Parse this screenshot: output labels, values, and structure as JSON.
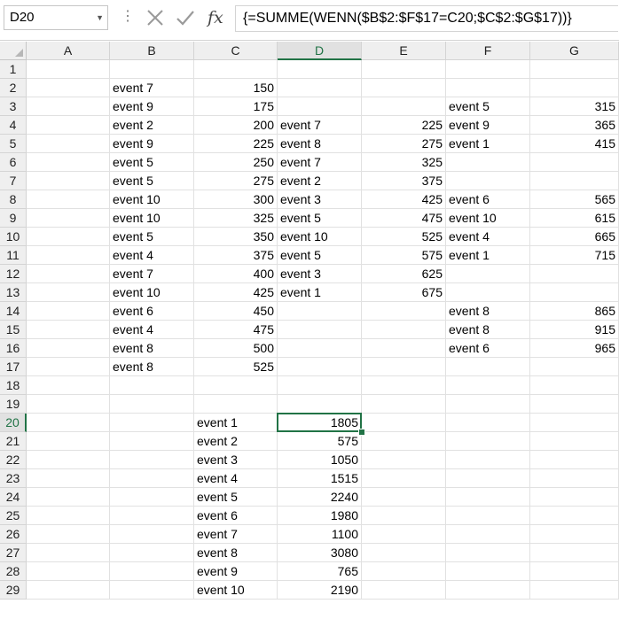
{
  "formula_bar": {
    "name_box": "D20",
    "formula": "{=SUMME(WENN($B$2:$F$17=C20;$C$2:$G$17))}"
  },
  "sheet": {
    "active_cell": "D20",
    "columns": [
      "A",
      "B",
      "C",
      "D",
      "E",
      "F",
      "G"
    ],
    "rows": [
      "1",
      "2",
      "3",
      "4",
      "5",
      "6",
      "7",
      "8",
      "9",
      "10",
      "11",
      "12",
      "13",
      "14",
      "15",
      "16",
      "17",
      "18",
      "19",
      "20",
      "21",
      "22",
      "23",
      "24",
      "25",
      "26",
      "27",
      "28",
      "29"
    ],
    "cells": [
      {
        "ref": "B2",
        "value": "event 7"
      },
      {
        "ref": "C2",
        "value": "150"
      },
      {
        "ref": "B3",
        "value": "event 9"
      },
      {
        "ref": "C3",
        "value": "175"
      },
      {
        "ref": "F3",
        "value": "event 5"
      },
      {
        "ref": "G3",
        "value": "315"
      },
      {
        "ref": "B4",
        "value": "event 2"
      },
      {
        "ref": "C4",
        "value": "200"
      },
      {
        "ref": "D4",
        "value": "event 7"
      },
      {
        "ref": "E4",
        "value": "225"
      },
      {
        "ref": "F4",
        "value": "event 9"
      },
      {
        "ref": "G4",
        "value": "365"
      },
      {
        "ref": "B5",
        "value": "event 9"
      },
      {
        "ref": "C5",
        "value": "225"
      },
      {
        "ref": "D5",
        "value": "event 8"
      },
      {
        "ref": "E5",
        "value": "275"
      },
      {
        "ref": "F5",
        "value": "event 1"
      },
      {
        "ref": "G5",
        "value": "415"
      },
      {
        "ref": "B6",
        "value": "event 5"
      },
      {
        "ref": "C6",
        "value": "250"
      },
      {
        "ref": "D6",
        "value": "event 7"
      },
      {
        "ref": "E6",
        "value": "325"
      },
      {
        "ref": "B7",
        "value": "event 5"
      },
      {
        "ref": "C7",
        "value": "275"
      },
      {
        "ref": "D7",
        "value": "event 2"
      },
      {
        "ref": "E7",
        "value": "375"
      },
      {
        "ref": "B8",
        "value": "event 10"
      },
      {
        "ref": "C8",
        "value": "300"
      },
      {
        "ref": "D8",
        "value": "event 3"
      },
      {
        "ref": "E8",
        "value": "425"
      },
      {
        "ref": "F8",
        "value": "event 6"
      },
      {
        "ref": "G8",
        "value": "565"
      },
      {
        "ref": "B9",
        "value": "event 10"
      },
      {
        "ref": "C9",
        "value": "325"
      },
      {
        "ref": "D9",
        "value": "event 5"
      },
      {
        "ref": "E9",
        "value": "475"
      },
      {
        "ref": "F9",
        "value": "event 10"
      },
      {
        "ref": "G9",
        "value": "615"
      },
      {
        "ref": "B10",
        "value": "event 5"
      },
      {
        "ref": "C10",
        "value": "350"
      },
      {
        "ref": "D10",
        "value": "event 10"
      },
      {
        "ref": "E10",
        "value": "525"
      },
      {
        "ref": "F10",
        "value": "event 4"
      },
      {
        "ref": "G10",
        "value": "665"
      },
      {
        "ref": "B11",
        "value": "event 4"
      },
      {
        "ref": "C11",
        "value": "375"
      },
      {
        "ref": "D11",
        "value": "event 5"
      },
      {
        "ref": "E11",
        "value": "575"
      },
      {
        "ref": "F11",
        "value": "event 1"
      },
      {
        "ref": "G11",
        "value": "715"
      },
      {
        "ref": "B12",
        "value": "event 7"
      },
      {
        "ref": "C12",
        "value": "400"
      },
      {
        "ref": "D12",
        "value": "event 3"
      },
      {
        "ref": "E12",
        "value": "625"
      },
      {
        "ref": "B13",
        "value": "event 10"
      },
      {
        "ref": "C13",
        "value": "425"
      },
      {
        "ref": "D13",
        "value": "event 1"
      },
      {
        "ref": "E13",
        "value": "675"
      },
      {
        "ref": "B14",
        "value": "event 6"
      },
      {
        "ref": "C14",
        "value": "450"
      },
      {
        "ref": "F14",
        "value": "event 8"
      },
      {
        "ref": "G14",
        "value": "865"
      },
      {
        "ref": "B15",
        "value": "event 4"
      },
      {
        "ref": "C15",
        "value": "475"
      },
      {
        "ref": "F15",
        "value": "event 8"
      },
      {
        "ref": "G15",
        "value": "915"
      },
      {
        "ref": "B16",
        "value": "event 8"
      },
      {
        "ref": "C16",
        "value": "500"
      },
      {
        "ref": "F16",
        "value": "event 6"
      },
      {
        "ref": "G16",
        "value": "965"
      },
      {
        "ref": "B17",
        "value": "event 8"
      },
      {
        "ref": "C17",
        "value": "525"
      },
      {
        "ref": "C20",
        "value": "event 1"
      },
      {
        "ref": "D20",
        "value": "1805"
      },
      {
        "ref": "C21",
        "value": "event 2"
      },
      {
        "ref": "D21",
        "value": "575"
      },
      {
        "ref": "C22",
        "value": "event 3"
      },
      {
        "ref": "D22",
        "value": "1050"
      },
      {
        "ref": "C23",
        "value": "event 4"
      },
      {
        "ref": "D23",
        "value": "1515"
      },
      {
        "ref": "C24",
        "value": "event 5"
      },
      {
        "ref": "D24",
        "value": "2240"
      },
      {
        "ref": "C25",
        "value": "event 6"
      },
      {
        "ref": "D25",
        "value": "1980"
      },
      {
        "ref": "C26",
        "value": "event 7"
      },
      {
        "ref": "D26",
        "value": "1100"
      },
      {
        "ref": "C27",
        "value": "event 8"
      },
      {
        "ref": "D27",
        "value": "3080"
      },
      {
        "ref": "C28",
        "value": "event 9"
      },
      {
        "ref": "D28",
        "value": "765"
      },
      {
        "ref": "C29",
        "value": "event 10"
      },
      {
        "ref": "D29",
        "value": "2190"
      }
    ]
  }
}
